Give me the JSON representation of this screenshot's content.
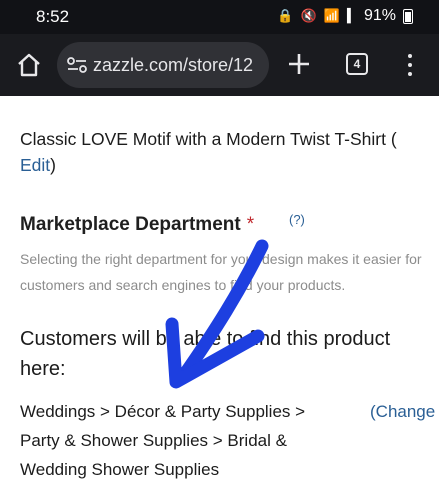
{
  "status_bar": {
    "time": "8:52",
    "battery": "91%"
  },
  "browser": {
    "url": "zazzle.com/store/12",
    "tab_count": "4"
  },
  "page": {
    "product_title": "Classic LOVE Motif with a Modern Twist T-Shirt (",
    "edit_link": "Edit",
    "product_title_close": ")",
    "department_heading": "Marketplace Department",
    "required_marker": "*",
    "help_link": "(?)",
    "department_description": "Selecting the right department for your design makes it easier for customers and search engines to find your products.",
    "customers_text": "Customers will be able to find this product here:",
    "category_path": "Weddings > Décor & Party Supplies > Party & Shower Supplies > Bridal & Wedding Shower Supplies",
    "change_link": "(Change"
  },
  "annotation": {
    "arrow_color": "#1d3fe0"
  },
  "colors": {
    "link": "#2a5f95",
    "required": "#c0282d",
    "browser_bar": "#1a1b1f"
  }
}
